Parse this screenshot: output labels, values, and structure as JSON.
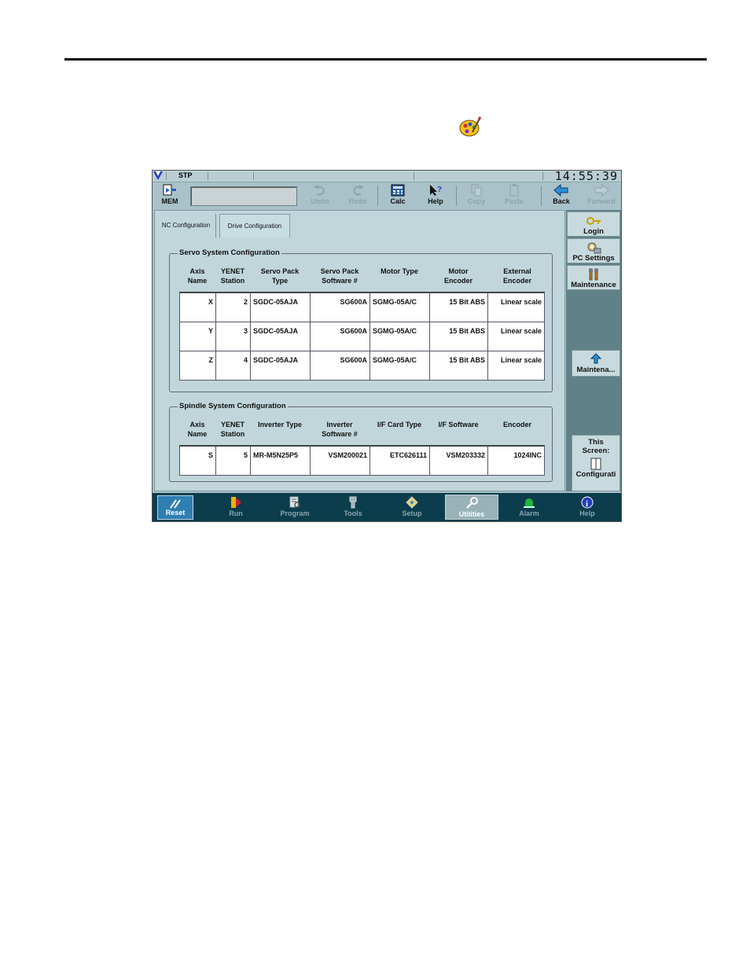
{
  "status": {
    "mode": "STP",
    "clock": "14:55:39"
  },
  "toolbar": {
    "mem": "MEM",
    "undo": "Undo",
    "redo": "Redo",
    "calc": "Calc",
    "help": "Help",
    "copy": "Copy",
    "paste": "Paste",
    "back": "Back",
    "forward": "Forward"
  },
  "tabs": [
    {
      "label": "NC Configuration"
    },
    {
      "label": "Drive Configuration"
    }
  ],
  "servo": {
    "title": "Servo System Configuration",
    "headers": [
      [
        "Axis",
        "Name"
      ],
      [
        "YENET",
        "Station"
      ],
      [
        "Servo Pack",
        "Type"
      ],
      [
        "Servo Pack",
        "Software #"
      ],
      [
        "Motor Type",
        ""
      ],
      [
        "Motor",
        "Encoder"
      ],
      [
        "External",
        "Encoder"
      ]
    ],
    "rows": [
      [
        "X",
        "2",
        "SGDC-05AJA",
        "SG600A",
        "SGMG-05A/C",
        "15 Bit ABS",
        "Linear scale"
      ],
      [
        "Y",
        "3",
        "SGDC-05AJA",
        "SG600A",
        "SGMG-05A/C",
        "15 Bit ABS",
        "Linear scale"
      ],
      [
        "Z",
        "4",
        "SGDC-05AJA",
        "SG600A",
        "SGMG-05A/C",
        "15 Bit ABS",
        "Linear scale"
      ]
    ]
  },
  "spindle": {
    "title": "Spindle System Configuration",
    "headers": [
      [
        "Axis",
        "Name"
      ],
      [
        "YENET",
        "Station"
      ],
      [
        "Inverter Type",
        ""
      ],
      [
        "Inverter",
        "Software #"
      ],
      [
        "I/F Card Type",
        ""
      ],
      [
        "I/F Software",
        ""
      ],
      [
        "Encoder",
        ""
      ]
    ],
    "rows": [
      [
        "S",
        "5",
        "MR-M5N25P5",
        "VSM200021",
        "ETC626111",
        "VSM203332",
        "1024INC"
      ]
    ]
  },
  "sidebar": {
    "login": "Login",
    "pc_settings": "PC Settings",
    "maintenance": "Maintenance",
    "maint_button": "Maintena...",
    "this_screen": [
      "This",
      "Screen:"
    ],
    "config": "Configurati"
  },
  "nav": {
    "reset": "Reset",
    "run": "Run",
    "program": "Program",
    "tools": "Tools",
    "setup": "Setup",
    "utilities": "Utilities",
    "alarm": "Alarm",
    "help": "Help"
  },
  "colors": {
    "accent": "#2f7fb2",
    "bottombar": "#0b3d4c",
    "panel": "#c0d6db"
  }
}
